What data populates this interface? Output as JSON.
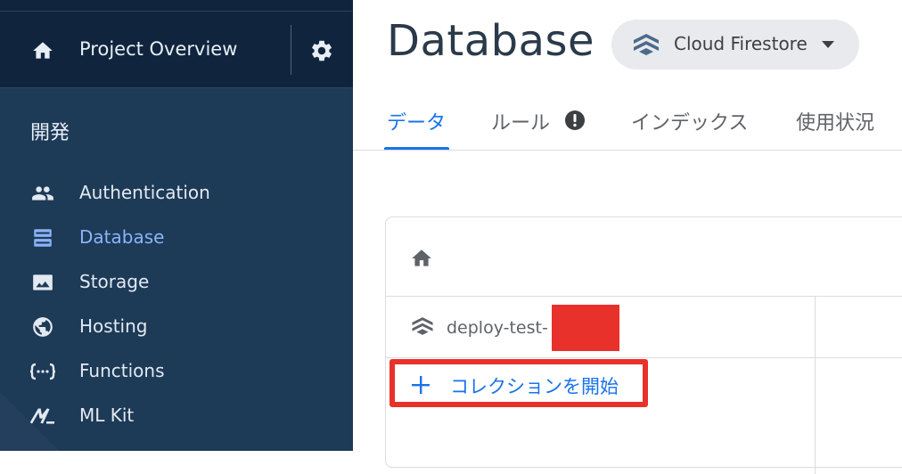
{
  "sidebar": {
    "header": {
      "project_label": "Project Overview",
      "home_icon": "home-icon",
      "settings_icon": "gear-icon"
    },
    "section_title": "開発",
    "items": [
      {
        "label": "Authentication",
        "icon": "people-icon",
        "active": false
      },
      {
        "label": "Database",
        "icon": "database-icon",
        "active": true
      },
      {
        "label": "Storage",
        "icon": "image-icon",
        "active": false
      },
      {
        "label": "Hosting",
        "icon": "globe-icon",
        "active": false
      },
      {
        "label": "Functions",
        "icon": "functions-icon",
        "active": false
      },
      {
        "label": "ML Kit",
        "icon": "ml-kit-icon",
        "active": false
      }
    ]
  },
  "main": {
    "title": "Database",
    "db_selector": {
      "label": "Cloud Firestore",
      "icon": "firestore-icon",
      "caret": "caret-down-icon"
    },
    "tabs": [
      {
        "label": "データ",
        "active": true
      },
      {
        "label": "ルール",
        "active": false,
        "badge": "warning-icon"
      },
      {
        "label": "インデックス",
        "active": false
      },
      {
        "label": "使用状況",
        "active": false
      }
    ],
    "panel": {
      "home_icon": "home-icon",
      "project_id": "deploy-test-",
      "add_collection_label": "コレクションを開始"
    }
  },
  "colors": {
    "sidebar_bg": "#1d3a57",
    "sidebar_top_bg": "#10253d",
    "active_nav": "#8ab4f8",
    "accent": "#1a73e8",
    "highlight": "#e8312a"
  }
}
